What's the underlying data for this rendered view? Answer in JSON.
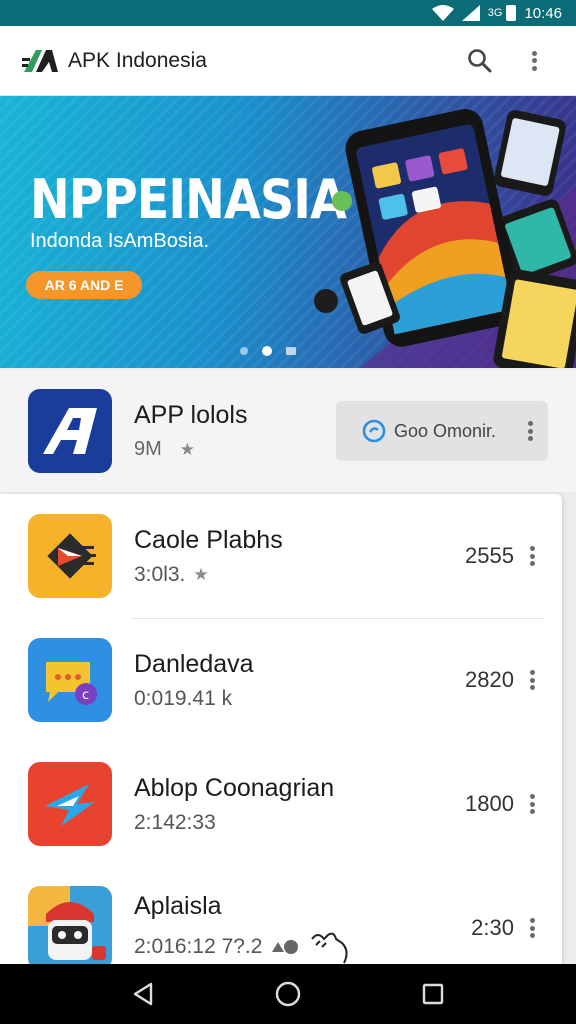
{
  "status_bar": {
    "network": "3G",
    "time": "10:46"
  },
  "app_bar": {
    "title": "APK Indonesia"
  },
  "banner": {
    "title": "NPPEINASIA",
    "subtitle": "Indonda IsAmBosia.",
    "cta_label": "AR 6 AND E"
  },
  "featured": {
    "name": "APP lolols",
    "meta": "9M",
    "install_label": "Goo Omonir.",
    "icon_colors": [
      "#1a3d9c",
      "#ffffff"
    ]
  },
  "apps": [
    {
      "name": "Caole Plabhs",
      "meta": "3:0l3.",
      "has_star": true,
      "count": "2555"
    },
    {
      "name": "Danledava",
      "meta": "0:019.41 k",
      "has_star": false,
      "count": "2820"
    },
    {
      "name": "Ablop Coonagrian",
      "meta": "2:142:33",
      "has_star": false,
      "count": "1800"
    },
    {
      "name": "Aplaisla",
      "meta": "2:016:12 7?.2",
      "has_star": false,
      "count": "2:30"
    }
  ],
  "colors": {
    "status_bar": "#0b6c77",
    "accent_orange": "#f5962a",
    "featured_icon": "#1a3d9c"
  }
}
